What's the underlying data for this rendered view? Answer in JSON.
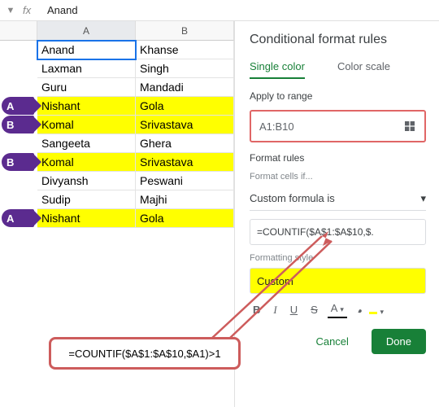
{
  "formula_bar": {
    "content": "Anand"
  },
  "columns": [
    "A",
    "B"
  ],
  "rows": [
    {
      "a": "Anand",
      "b": "Khanse",
      "hl": false,
      "badge": null,
      "active": true
    },
    {
      "a": "Laxman",
      "b": "Singh",
      "hl": false,
      "badge": null
    },
    {
      "a": "Guru",
      "b": "Mandadi",
      "hl": false,
      "badge": null
    },
    {
      "a": "Nishant",
      "b": "Gola",
      "hl": true,
      "badge": "A"
    },
    {
      "a": "Komal",
      "b": "Srivastava",
      "hl": true,
      "badge": "B"
    },
    {
      "a": "Sangeeta",
      "b": "Ghera",
      "hl": false,
      "badge": null
    },
    {
      "a": "Komal",
      "b": "Srivastava",
      "hl": true,
      "badge": "B"
    },
    {
      "a": "Divyansh",
      "b": "Peswani",
      "hl": false,
      "badge": null
    },
    {
      "a": "Sudip",
      "b": "Majhi",
      "hl": false,
      "badge": null
    },
    {
      "a": "Nishant",
      "b": "Gola",
      "hl": true,
      "badge": "A"
    }
  ],
  "panel": {
    "title": "Conditional format rules",
    "tabs": {
      "single": "Single color",
      "scale": "Color scale"
    },
    "apply_label": "Apply to range",
    "range": "A1:B10",
    "rules_label": "Format rules",
    "cells_if_label": "Format cells if...",
    "condition": "Custom formula is",
    "formula": "=COUNTIF($A$1:$A$10,$.",
    "style_label": "Formatting style",
    "style_name": "Custom",
    "fmt": {
      "bold": "B",
      "italic": "I",
      "underline": "U",
      "strike": "S",
      "textcolor": "A",
      "fillcolor": "▾"
    },
    "cancel": "Cancel",
    "done": "Done"
  },
  "callout": "=COUNTIF($A$1:$A$10,$A1)>1"
}
